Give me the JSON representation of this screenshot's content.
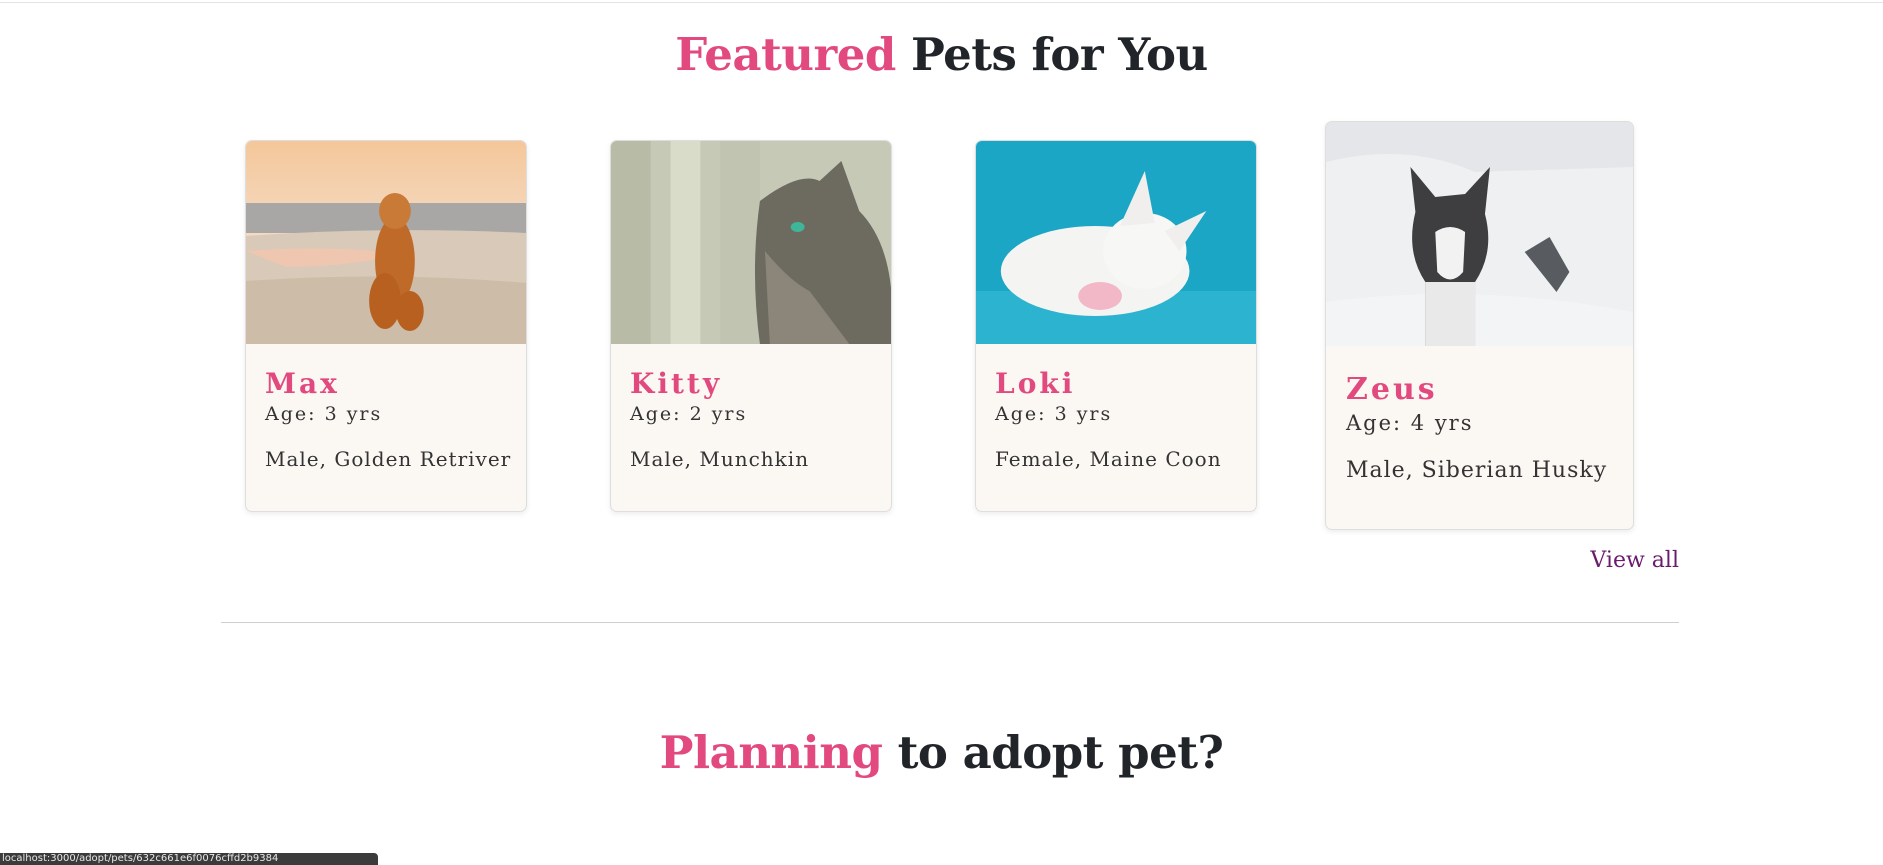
{
  "featured": {
    "title_accent": "Featured",
    "title_rest": " Pets for You",
    "view_all": "View all"
  },
  "pets": [
    {
      "name": "Max",
      "age": "Age: 3 yrs",
      "desc": "Male, Golden Retriver",
      "photo": "golden-retriever-on-beach"
    },
    {
      "name": "Kitty",
      "age": "Age: 2 yrs",
      "desc": "Male, Munchkin",
      "photo": "tabby-cat-profile"
    },
    {
      "name": "Loki",
      "age": "Age: 3 yrs",
      "desc": "Female, Maine Coon",
      "photo": "white-kitten-on-blue"
    },
    {
      "name": "Zeus",
      "age": "Age: 4 yrs",
      "desc": "Male, Siberian Husky",
      "photo": "husky-in-snow"
    }
  ],
  "planning": {
    "title_accent": "Planning",
    "title_rest": " to adopt pet?"
  },
  "status_bar": {
    "text": "localhost:3000/adopt/pets/632c661e6f0076cffd2b9384"
  },
  "colors": {
    "accent": "#e2497f",
    "link": "#6a1b6e",
    "card_bg": "#fbf8f4",
    "heading": "#212529"
  }
}
